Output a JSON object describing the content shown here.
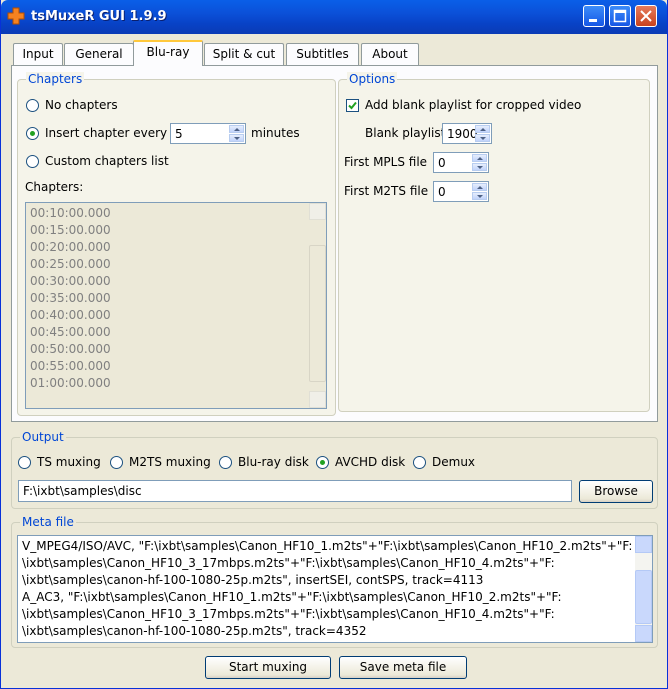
{
  "window": {
    "title": "tsMuxeR GUI 1.9.9"
  },
  "tabs": [
    {
      "label": "Input"
    },
    {
      "label": "General"
    },
    {
      "label": "Blu-ray"
    },
    {
      "label": "Split & cut"
    },
    {
      "label": "Subtitles"
    },
    {
      "label": "About"
    }
  ],
  "chapters": {
    "legend": "Chapters",
    "no_chapters": "No chapters",
    "insert_every": "Insert chapter every",
    "interval_value": "5",
    "minutes": "minutes",
    "custom_list": "Custom chapters list",
    "list_label": "Chapters:",
    "list": [
      "00:10:00.000",
      "00:15:00.000",
      "00:20:00.000",
      "00:25:00.000",
      "00:30:00.000",
      "00:35:00.000",
      "00:40:00.000",
      "00:45:00.000",
      "00:50:00.000",
      "00:55:00.000",
      "01:00:00.000"
    ]
  },
  "options": {
    "legend": "Options",
    "add_blank": "Add blank playlist for cropped video",
    "blank_playlist_label": "Blank playlist",
    "blank_playlist_value": "1900",
    "first_mpls_label": "First MPLS file",
    "first_mpls_value": "0",
    "first_m2ts_label": "First M2TS file",
    "first_m2ts_value": "0"
  },
  "output": {
    "legend": "Output",
    "modes": [
      "TS muxing",
      "M2TS muxing",
      "Blu-ray disk",
      "AVCHD disk",
      "Demux"
    ],
    "selected_mode": "AVCHD disk",
    "path": "F:\\ixbt\\samples\\disc",
    "browse": "Browse"
  },
  "meta": {
    "legend": "Meta file",
    "lines": [
      "V_MPEG4/ISO/AVC, \"F:\\ixbt\\samples\\Canon_HF10_1.m2ts\"+\"F:\\ixbt\\samples\\Canon_HF10_2.m2ts\"+\"F:",
      "\\ixbt\\samples\\Canon_HF10_3_17mbps.m2ts\"+\"F:\\ixbt\\samples\\Canon_HF10_4.m2ts\"+\"F:",
      "\\ixbt\\samples\\canon-hf-100-1080-25p.m2ts\", insertSEI, contSPS, track=4113",
      "A_AC3, \"F:\\ixbt\\samples\\Canon_HF10_1.m2ts\"+\"F:\\ixbt\\samples\\Canon_HF10_2.m2ts\"+\"F:",
      "\\ixbt\\samples\\Canon_HF10_3_17mbps.m2ts\"+\"F:\\ixbt\\samples\\Canon_HF10_4.m2ts\"+\"F:",
      "\\ixbt\\samples\\canon-hf-100-1080-25p.m2ts\", track=4352"
    ]
  },
  "buttons": {
    "start": "Start muxing",
    "save_meta": "Save meta file"
  }
}
